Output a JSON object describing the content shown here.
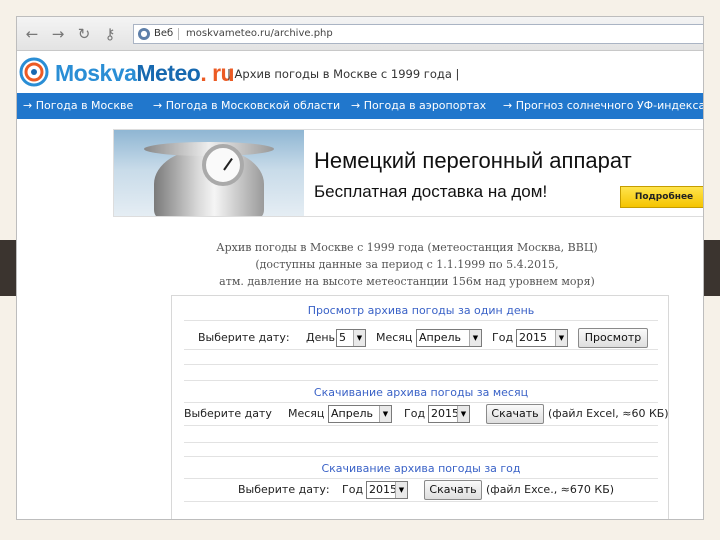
{
  "browser": {
    "address_label": "Веб",
    "url": "moskvameteo.ru/archive.php"
  },
  "header": {
    "logo_moskva": "Moskva",
    "logo_meteo": "Meteo",
    "logo_ru": ". ru",
    "title": "| Архив погоды в Москве с 1999 года |"
  },
  "nav": {
    "items": [
      "→ Погода в Москве",
      "→ Погода в Московской области",
      "→ Погода в аэропортах",
      "→ Прогноз солнечного УФ-индекса"
    ]
  },
  "banner": {
    "headline": "Немецкий перегонный аппарат",
    "subline": "Бесплатная доставка на дом!",
    "button": "Подробнее"
  },
  "archive": {
    "line1": "Архив погоды в Москве с 1999 года (метеостанция Москва, ВВЦ)",
    "line2": "(доступны данные за период с 1.1.1999 по 5.4.2015,",
    "line3": "атм. давление на высоте метеостанции 156м над уровнем моря)"
  },
  "day_section": {
    "title": "Просмотр архива погоды за один день",
    "choose_label": "Выберите дату:",
    "day_label": "День",
    "day_value": "5",
    "month_label": "Месяц",
    "month_value": "Апрель",
    "year_label": "Год",
    "year_value": "2015",
    "button": "Просмотр"
  },
  "month_section": {
    "title": "Скачивание архива погоды за месяц",
    "choose_label": "Выберите дату",
    "month_label": "Месяц",
    "month_value": "Апрель",
    "year_label": "Год",
    "year_value": "2015",
    "button": "Скачать",
    "file_info": "(файл Excel, ≈60 КБ)"
  },
  "year_section": {
    "title": "Скачивание архива погоды за год",
    "choose_label": "Выберите дату:",
    "year_label": "Год",
    "year_value": "2015",
    "button": "Скачать",
    "file_info": "(файл Exce., ≈670 КБ)"
  },
  "colors": {
    "nav_bg": "#2177cc",
    "section_title": "#3a62c7",
    "logo_ru": "#ec5b24",
    "slide_dark_band": "#3b342f"
  }
}
